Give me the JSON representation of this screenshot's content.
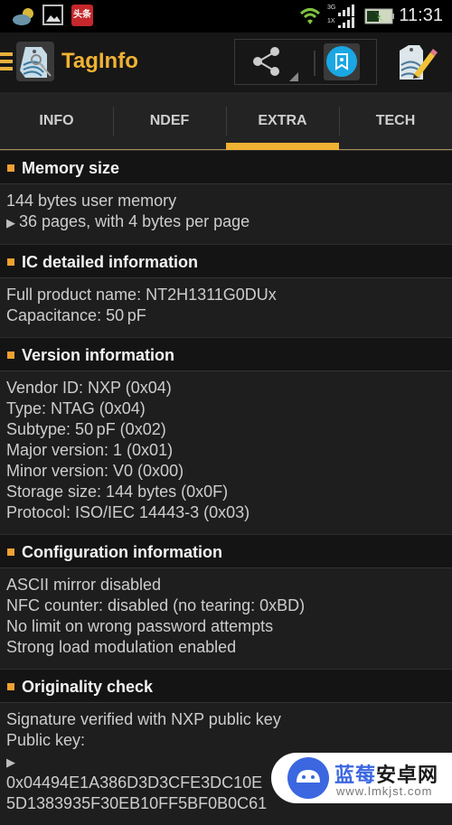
{
  "status_bar": {
    "notification_icons": [
      "weather-icon",
      "gallery-icon",
      "toutiao-app-icon"
    ],
    "toutiao_label": "头条",
    "network_labels": [
      "3G",
      "1X"
    ],
    "time": "11:31"
  },
  "action_bar": {
    "app_title": "TagInfo",
    "icons": [
      "menu-icon",
      "app-logo-icon",
      "share-icon",
      "bookmark-icon",
      "edit-tag-icon"
    ]
  },
  "tabs": [
    {
      "label": "INFO",
      "active": false
    },
    {
      "label": "NDEF",
      "active": false
    },
    {
      "label": "EXTRA",
      "active": true
    },
    {
      "label": "TECH",
      "active": false
    }
  ],
  "accent_color": "#f0b232",
  "sections": [
    {
      "title": "Memory size",
      "lines": [
        {
          "text": "144 bytes user memory",
          "expandable": false
        },
        {
          "text": "36 pages, with 4 bytes per page",
          "expandable": true
        }
      ]
    },
    {
      "title": "IC detailed information",
      "lines": [
        {
          "text": "Full product name: NT2H1311G0DUx",
          "expandable": false
        },
        {
          "text": "Capacitance: 50 pF",
          "expandable": false
        }
      ]
    },
    {
      "title": "Version information",
      "lines": [
        {
          "text": "Vendor ID: NXP (0x04)",
          "expandable": false
        },
        {
          "text": "Type: NTAG (0x04)",
          "expandable": false
        },
        {
          "text": "Subtype: 50 pF (0x02)",
          "expandable": false
        },
        {
          "text": "Major version: 1 (0x01)",
          "expandable": false
        },
        {
          "text": "Minor version: V0 (0x00)",
          "expandable": false
        },
        {
          "text": "Storage size: 144 bytes (0x0F)",
          "expandable": false
        },
        {
          "text": "Protocol: ISO/IEC 14443-3 (0x03)",
          "expandable": false
        }
      ]
    },
    {
      "title": "Configuration information",
      "lines": [
        {
          "text": "ASCII mirror disabled",
          "expandable": false
        },
        {
          "text": "NFC counter: disabled (no tearing: 0xBD)",
          "expandable": false
        },
        {
          "text": "No limit on wrong password attempts",
          "expandable": false
        },
        {
          "text": "Strong load modulation enabled",
          "expandable": false
        }
      ]
    },
    {
      "title": "Originality check",
      "lines": [
        {
          "text": "Signature verified with NXP public key",
          "expandable": false
        },
        {
          "text": "Public key:",
          "expandable": false
        },
        {
          "text": "",
          "expandable": true
        },
        {
          "text": "0x04494E1A386D3D3CFE3DC10E",
          "expandable": false
        },
        {
          "text": "5D1383935F30EB10FF5BF0B0C61",
          "expandable": false
        }
      ]
    }
  ],
  "watermark": {
    "title_blue": "蓝莓",
    "title_dark": "安卓网",
    "url": "www.lmkjst.com"
  }
}
